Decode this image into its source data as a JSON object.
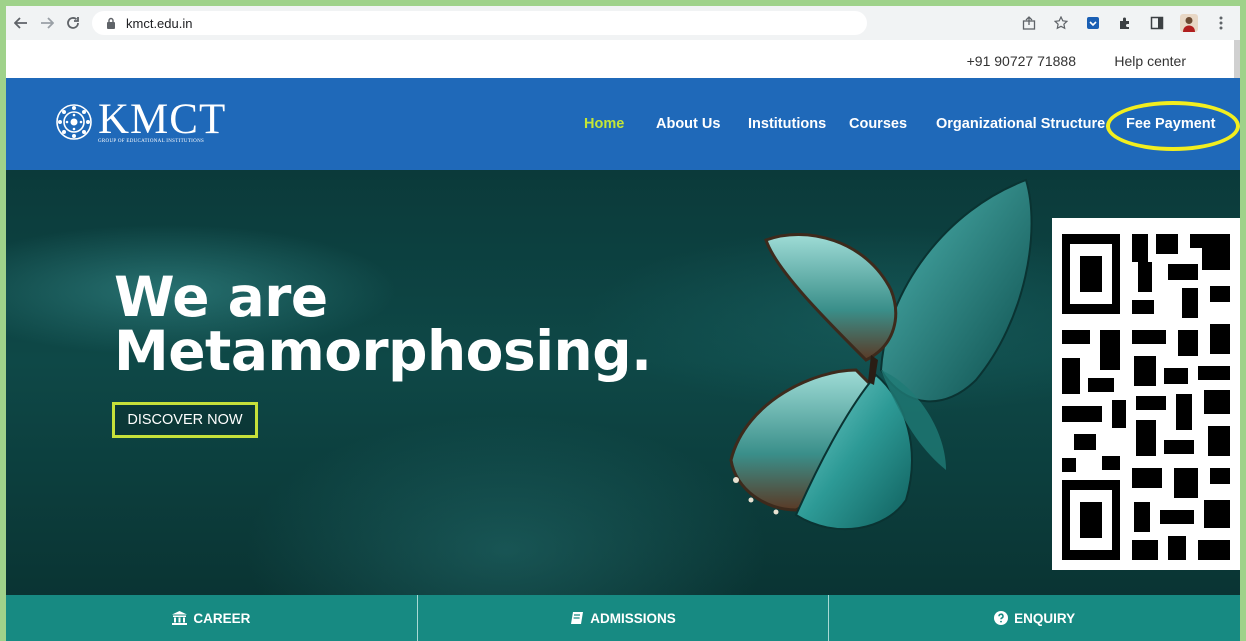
{
  "browser": {
    "url": "kmct.edu.in",
    "back_icon": "arrow-left-icon",
    "forward_icon": "arrow-right-icon",
    "reload_icon": "reload-icon"
  },
  "topbar": {
    "phone": "+91 90727 71888",
    "help": "Help center"
  },
  "header": {
    "logo_name": "KMCT",
    "logo_sub": "GROUP OF EDUCATIONAL INSTITUTIONS",
    "nav": [
      {
        "label": "Home",
        "active": true
      },
      {
        "label": "About Us"
      },
      {
        "label": "Institutions"
      },
      {
        "label": "Courses"
      },
      {
        "label": "Organizational Structure"
      },
      {
        "label": "Fee Payment"
      }
    ],
    "highlight_color": "#f2ee1f"
  },
  "hero": {
    "line1": "We are",
    "line2": "Metamorphosing.",
    "cta": "DISCOVER NOW",
    "cta_color": "#c6e03a"
  },
  "bottom_bar": {
    "items": [
      {
        "label": "CAREER",
        "icon": "institution-icon"
      },
      {
        "label": "ADMISSIONS",
        "icon": "book-icon"
      },
      {
        "label": "ENQUIRY",
        "icon": "question-circle-icon"
      }
    ],
    "color": "#178a82"
  },
  "colors": {
    "header_blue": "#1f69b9",
    "nav_active": "#c4e635",
    "frame_green": "#9fd28a"
  }
}
